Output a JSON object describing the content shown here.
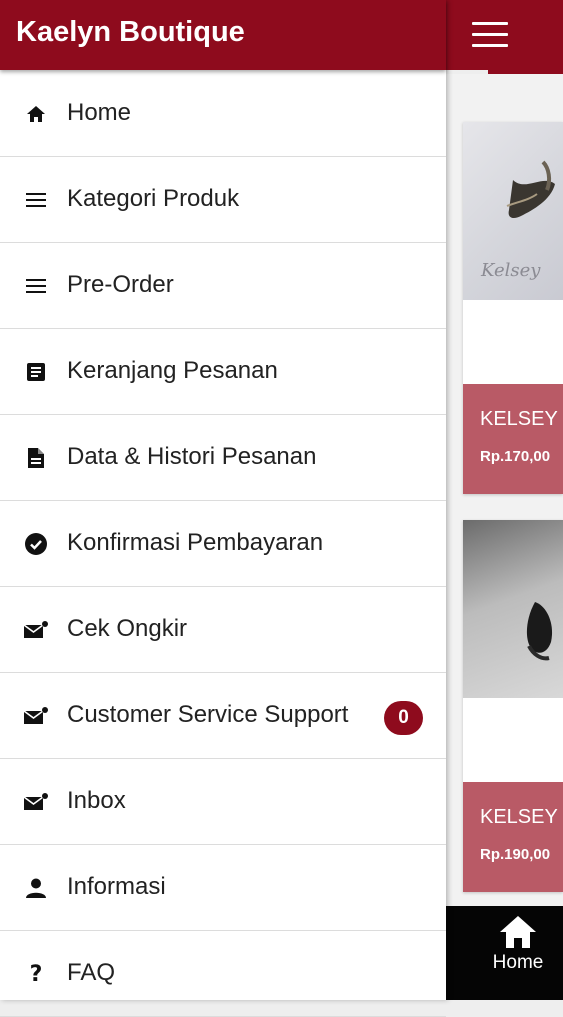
{
  "drawer": {
    "title": "Kaelyn Boutique",
    "items": [
      {
        "label": "Home",
        "icon": "home-icon"
      },
      {
        "label": "Kategori Produk",
        "icon": "menu-lines-icon"
      },
      {
        "label": "Pre-Order",
        "icon": "menu-lines-icon"
      },
      {
        "label": "Keranjang Pesanan",
        "icon": "list-box-icon"
      },
      {
        "label": "Data & Histori Pesanan",
        "icon": "document-icon"
      },
      {
        "label": "Konfirmasi Pembayaran",
        "icon": "check-circle-icon"
      },
      {
        "label": "Cek Ongkir",
        "icon": "mail-icon"
      },
      {
        "label": "Customer Service Support",
        "icon": "mail-icon",
        "badge": "0"
      },
      {
        "label": "Inbox",
        "icon": "mail-icon"
      },
      {
        "label": "Informasi",
        "icon": "person-icon"
      },
      {
        "label": "FAQ",
        "icon": "question-icon",
        "glyph": "?"
      }
    ]
  },
  "products": [
    {
      "name": "KELSEY",
      "price": "Rp.170,00",
      "logo_text": "Kelsey"
    },
    {
      "name": "KELSEY",
      "price": "Rp.190,00"
    }
  ],
  "bottom_nav": {
    "home_label": "Home"
  },
  "colors": {
    "brand": "#8e0b1d",
    "card_info": "#b95a66",
    "nav_bg": "#050505"
  }
}
